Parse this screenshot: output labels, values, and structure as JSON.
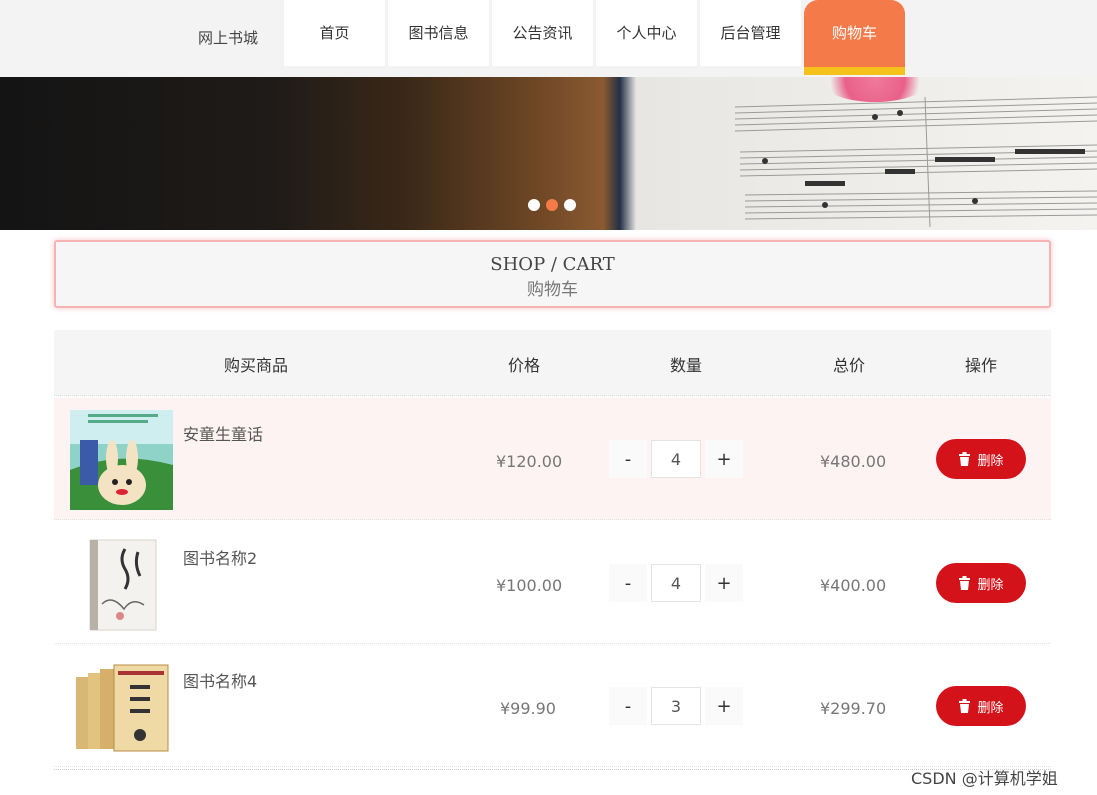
{
  "nav": {
    "brand": "网上书城",
    "items": [
      {
        "label": "首页"
      },
      {
        "label": "图书信息"
      },
      {
        "label": "公告资讯"
      },
      {
        "label": "个人中心"
      },
      {
        "label": "后台管理"
      },
      {
        "label": "购物车",
        "active": true
      }
    ]
  },
  "carousel": {
    "slide_count": 3,
    "active_index": 1
  },
  "section": {
    "title_en": "SHOP / CART",
    "title_cn": "购物车"
  },
  "table": {
    "headers": {
      "product": "购买商品",
      "price": "价格",
      "quantity": "数量",
      "total": "总价",
      "action": "操作"
    },
    "rows": [
      {
        "title": "安童生童话",
        "price": "¥120.00",
        "quantity": "4",
        "total": "¥480.00",
        "delete_label": "删除",
        "cover_icon": "book-cover-cartoon-rabbit"
      },
      {
        "title": "图书名称2",
        "price": "¥100.00",
        "quantity": "4",
        "total": "¥400.00",
        "delete_label": "删除",
        "cover_icon": "book-cover-white"
      },
      {
        "title": "图书名称4",
        "price": "¥99.90",
        "quantity": "3",
        "total": "¥299.70",
        "delete_label": "删除",
        "cover_icon": "book-cover-boxset"
      }
    ],
    "minus_label": "-",
    "plus_label": "+"
  },
  "colors": {
    "accent": "#f47a4a",
    "accent_underline": "#f5c21c",
    "delete_button": "#d3121a"
  },
  "watermark": "CSDN @计算机学姐"
}
